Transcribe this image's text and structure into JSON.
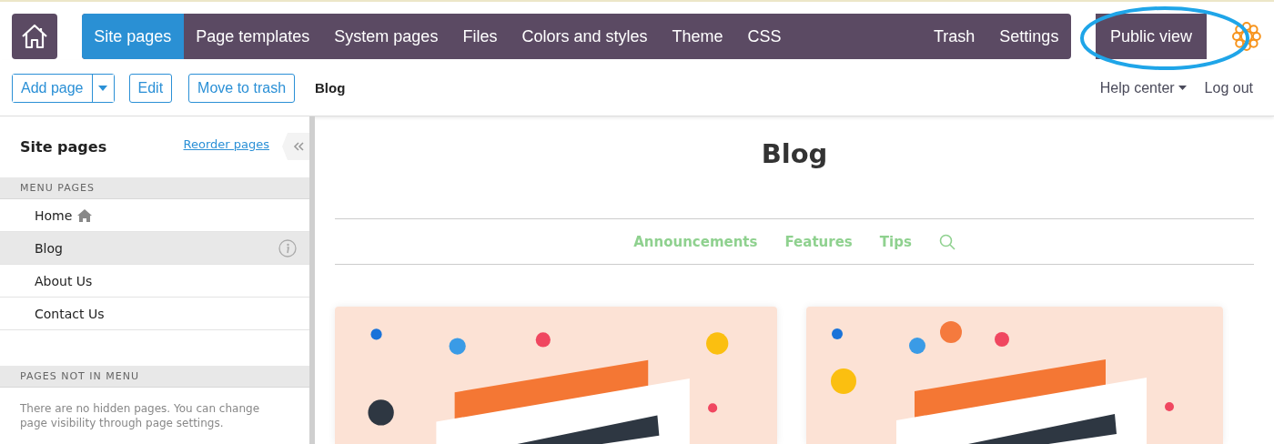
{
  "nav": {
    "tabs": [
      {
        "label": "Site pages",
        "selected": true
      },
      {
        "label": "Page templates",
        "selected": false
      },
      {
        "label": "System pages",
        "selected": false
      },
      {
        "label": "Files",
        "selected": false
      },
      {
        "label": "Colors and styles",
        "selected": false
      },
      {
        "label": "Theme",
        "selected": false
      },
      {
        "label": "CSS",
        "selected": false
      }
    ],
    "right_tabs": [
      {
        "label": "Trash",
        "selected": false
      },
      {
        "label": "Settings",
        "selected": false
      }
    ],
    "public_view": "Public view"
  },
  "toolbar": {
    "add_page": "Add page",
    "buttons": [
      "Edit",
      "Move to trash"
    ],
    "current_page": "Blog",
    "help_center": "Help center",
    "log_out": "Log out"
  },
  "sidebar": {
    "title": "Site pages",
    "reorder_link": "Reorder pages",
    "sections": [
      {
        "heading": "MENU PAGES",
        "items": [
          {
            "label": "Home",
            "kind": "home",
            "selected": false
          },
          {
            "label": "Blog",
            "kind": "page",
            "selected": true
          },
          {
            "label": "About Us",
            "kind": "page",
            "selected": false
          },
          {
            "label": "Contact Us",
            "kind": "page",
            "selected": false
          }
        ]
      },
      {
        "heading": "PAGES NOT IN MENU",
        "empty_text": "There are no hidden pages. You can change page visibility through page settings."
      }
    ]
  },
  "content": {
    "title": "Blog",
    "categories": [
      "Announcements",
      "Features",
      "Tips"
    ],
    "cards": [
      {
        "kind": "picture"
      },
      {
        "kind": "picture"
      }
    ]
  }
}
